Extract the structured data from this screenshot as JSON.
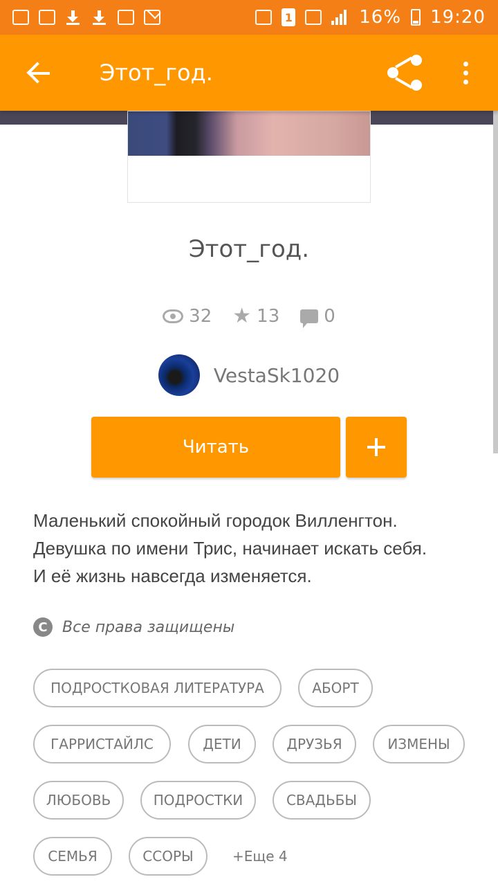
{
  "status_bar": {
    "battery": "16%",
    "time": "19:20",
    "sim": "1",
    "icons": [
      "cleaner-icon",
      "video-icon",
      "download-icon",
      "download-icon",
      "gallery-icon",
      "mail-icon",
      "mute-icon",
      "sim-icon",
      "network-icon",
      "signal-icon",
      "battery-icon"
    ]
  },
  "app_bar": {
    "title": "Этот_год.",
    "icons": [
      "back-arrow-icon",
      "share-icon",
      "more-vert-icon"
    ]
  },
  "book": {
    "title": "Этот_год.",
    "views": "32",
    "votes": "13",
    "comments": "0",
    "author": "VestaSk1020"
  },
  "actions": {
    "read_label": "Читать",
    "add_icon": "plus-icon"
  },
  "description": [
    "Маленький спокойный городок Вилленгтон.",
    "Девушка по имени Трис, начинает искать себя.",
    "И её жизнь навсегда изменяется."
  ],
  "copyright": {
    "text": "Все права защищены"
  },
  "tags": [
    "подростковая литература",
    "аборт",
    "гарристайлс",
    "дети",
    "друзья",
    "измены",
    "любовь",
    "подростки",
    "свадьбы",
    "семья",
    "ссоры"
  ],
  "more_tags": "+Еще 4",
  "colors": {
    "status_bar": "#f57f17",
    "app_bar": "#ff9800",
    "button": "#ff9800",
    "tag_border": "#bbbbbb"
  }
}
